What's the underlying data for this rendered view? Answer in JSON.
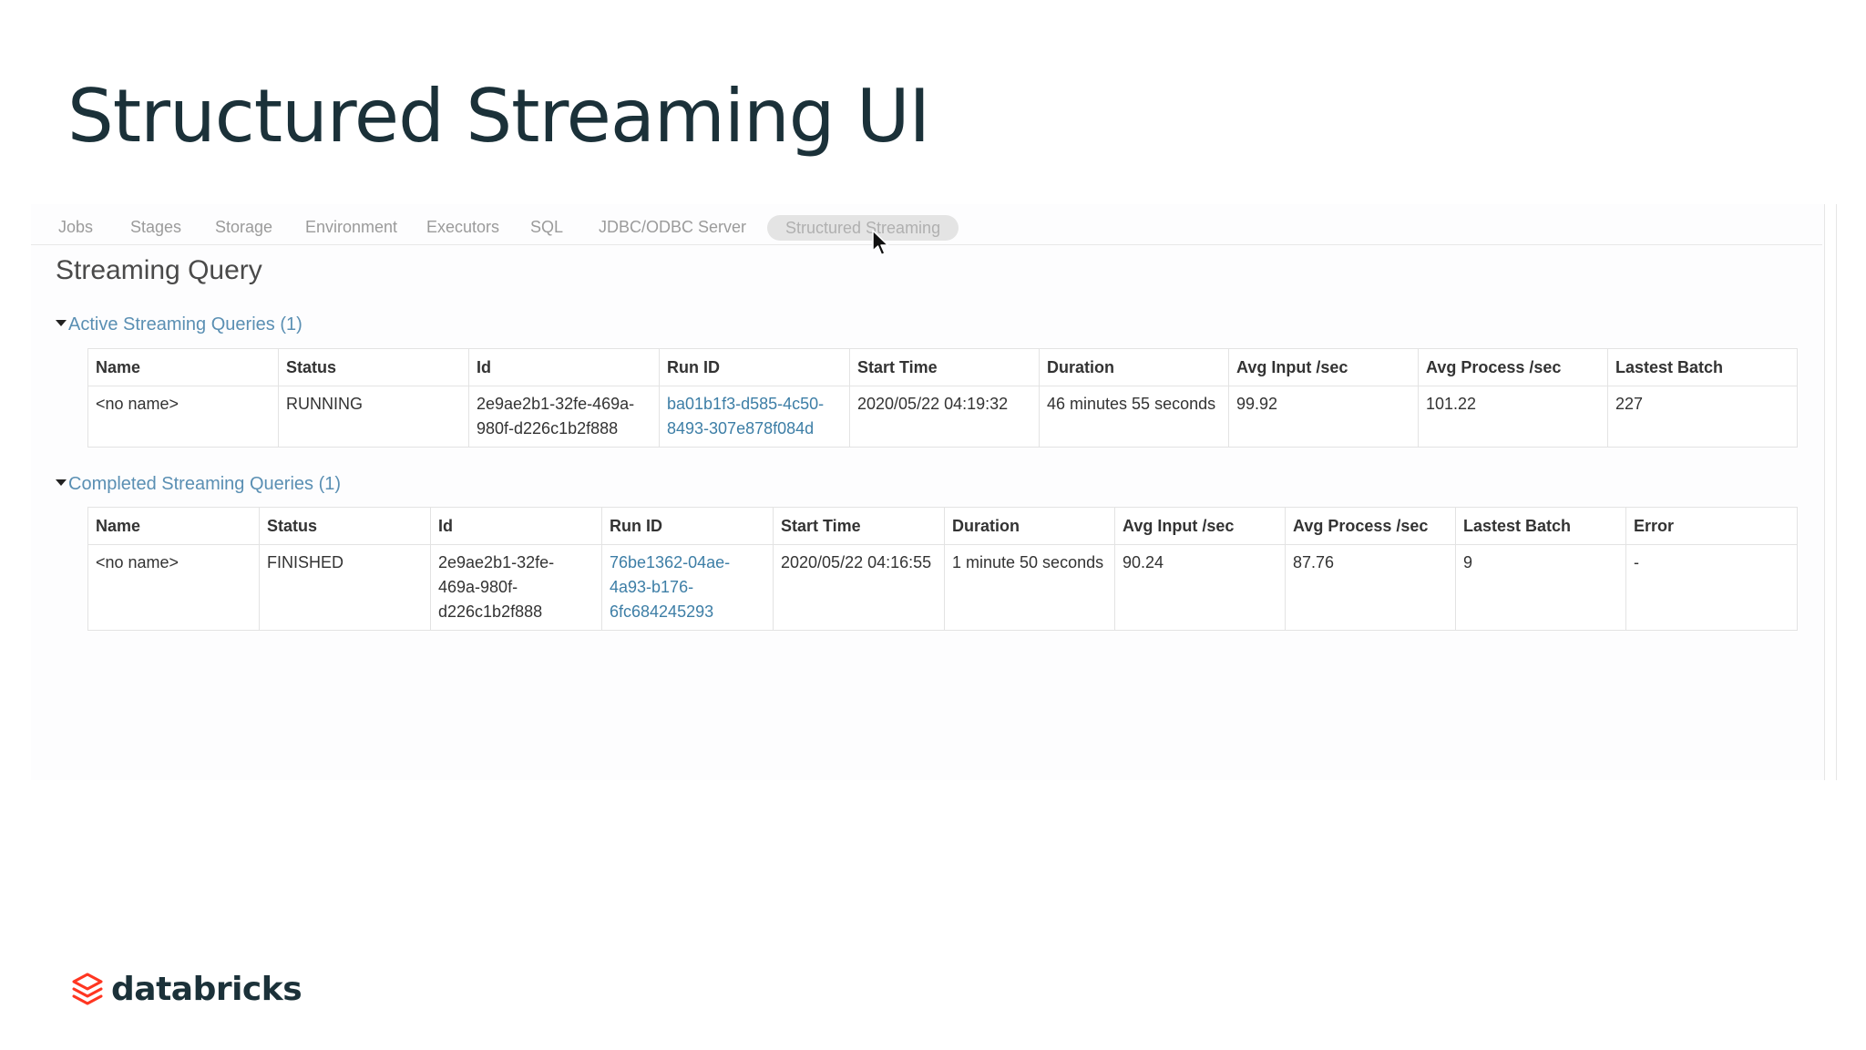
{
  "slide": {
    "title": "Structured Streaming UI"
  },
  "nav": {
    "tabs": [
      {
        "label": "Jobs"
      },
      {
        "label": "Stages"
      },
      {
        "label": "Storage"
      },
      {
        "label": "Environment"
      },
      {
        "label": "Executors"
      },
      {
        "label": "SQL"
      },
      {
        "label": "JDBC/ODBC Server"
      },
      {
        "label": "Structured Streaming",
        "active": true
      }
    ]
  },
  "page": {
    "heading": "Streaming Query"
  },
  "active_queries": {
    "toggle_label": "Active Streaming Queries (1)",
    "columns": [
      "Name",
      "Status",
      "Id",
      "Run ID",
      "Start Time",
      "Duration",
      "Avg Input /sec",
      "Avg Process /sec",
      "Lastest Batch"
    ],
    "rows": [
      [
        "<no name>",
        "RUNNING",
        "2e9ae2b1-32fe-469a-980f-d226c1b2f888",
        "ba01b1f3-d585-4c50-8493-307e878f084d",
        "2020/05/22 04:19:32",
        "46 minutes 55 seconds",
        "99.92",
        "101.22",
        "227"
      ]
    ]
  },
  "completed_queries": {
    "toggle_label": "Completed Streaming Queries (1)",
    "columns": [
      "Name",
      "Status",
      "Id",
      "Run ID",
      "Start Time",
      "Duration",
      "Avg Input /sec",
      "Avg Process /sec",
      "Lastest Batch",
      "Error"
    ],
    "rows": [
      [
        "<no name>",
        "FINISHED",
        "2e9ae2b1-32fe-469a-980f-d226c1b2f888",
        "76be1362-04ae-4a93-b176-6fc684245293",
        "2020/05/22 04:16:55",
        "1 minute 50 seconds",
        "90.24",
        "87.76",
        "9",
        "-"
      ]
    ]
  },
  "brand": {
    "logo_text": "databricks",
    "logo_color": "#ff3621"
  }
}
